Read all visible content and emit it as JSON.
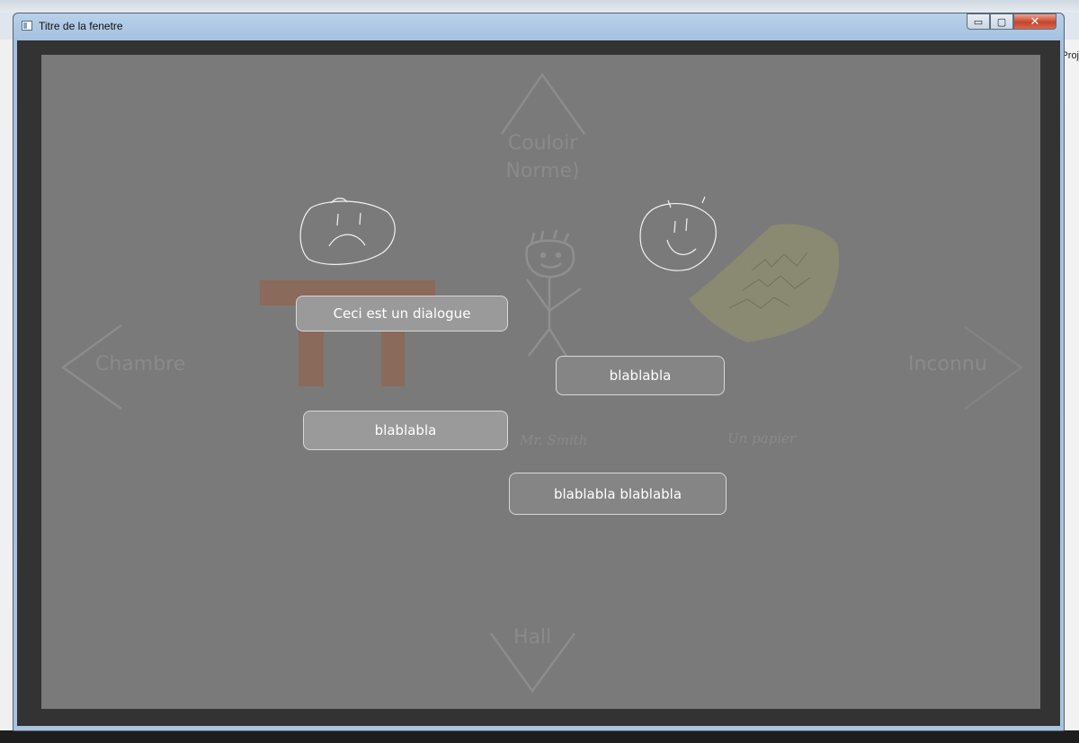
{
  "window": {
    "title": "Titre de la fenetre",
    "controls": {
      "minimize": "▭",
      "maximize": "▢",
      "close": "✕"
    }
  },
  "desktop": {
    "right_label": "Proj"
  },
  "scene": {
    "nav": {
      "north": "Couloir\nNorme)",
      "west": "Chambre",
      "east": "Inconnu",
      "south": "Hall"
    },
    "characters": {
      "smith_caption": "Mr. Smith",
      "paper_caption": "Un papier"
    },
    "dialogue": {
      "title": "Ceci est un dialogue",
      "options": [
        "blablabla",
        "blablabla",
        "blablabla blablabla"
      ]
    },
    "colors": {
      "background": "#7a7a7a",
      "frame": "#333333",
      "table": "#8a6a5a",
      "paper": "#8a8a72"
    }
  }
}
